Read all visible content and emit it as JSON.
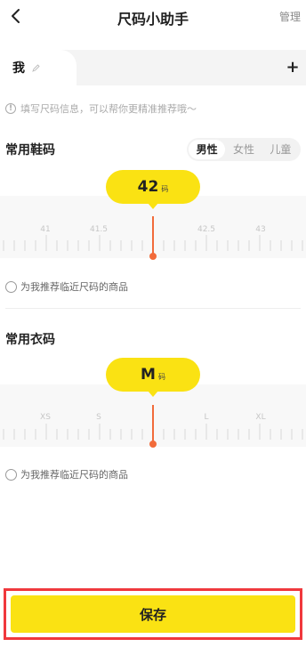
{
  "header": {
    "title": "尺码小助手",
    "manage_label": "管理"
  },
  "profile_tabs": {
    "active_label": "我",
    "add_label": "+"
  },
  "info_text": "填写尺码信息，可以帮你更精准推荐哦～",
  "shoe": {
    "section_title": "常用鞋码",
    "gender_options": [
      "男性",
      "女性",
      "儿童"
    ],
    "selected_gender": "男性",
    "value": "42",
    "unit": "码",
    "ruler_labels": [
      "41",
      "41.5",
      "42.5",
      "43"
    ],
    "recommend_label": "为我推荐临近尺码的商品"
  },
  "clothes": {
    "section_title": "常用衣码",
    "value": "M",
    "unit": "码",
    "ruler_labels": [
      "XS",
      "S",
      "L",
      "XL"
    ],
    "recommend_label": "为我推荐临近尺码的商品"
  },
  "save_label": "保存",
  "colors": {
    "accent": "#fae213",
    "indicator": "#f26b3a",
    "highlight_border": "#f0383d"
  }
}
